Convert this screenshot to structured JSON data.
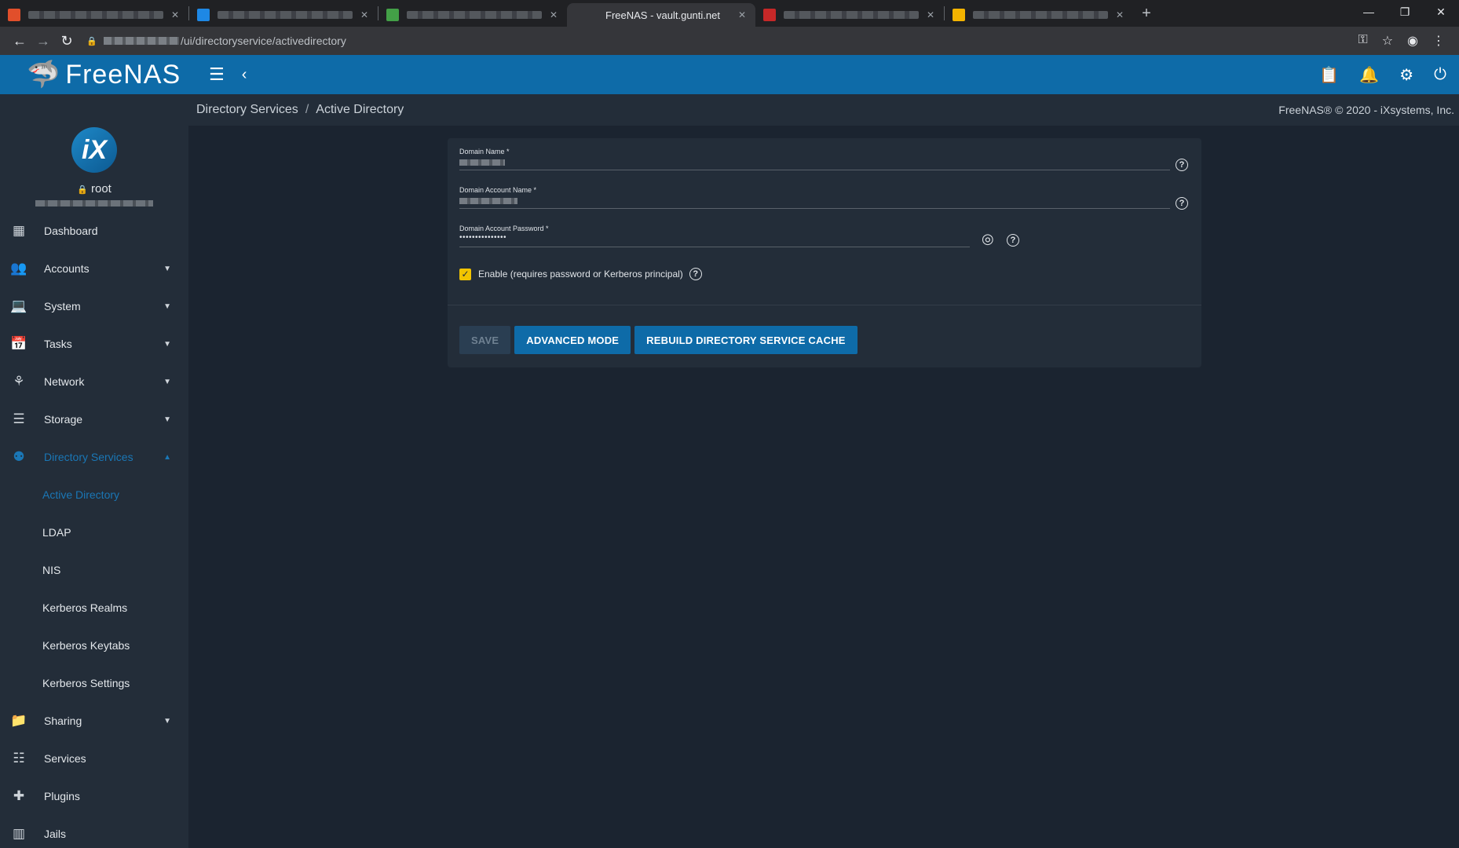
{
  "browser": {
    "tabs": [
      {
        "title": "",
        "favicon_color": "#e14f2b",
        "active": false
      },
      {
        "title": "",
        "favicon_color": "#1e88e5",
        "active": false
      },
      {
        "title": "",
        "favicon_color": "#43a047",
        "active": false
      },
      {
        "title": "FreeNAS - vault.gunti.net",
        "favicon_color": "#35363a",
        "active": true
      },
      {
        "title": "",
        "favicon_color": "#c62828",
        "active": false
      },
      {
        "title": "",
        "favicon_color": "#f4b400",
        "active": false
      }
    ],
    "url_path": "/ui/directoryservice/activedirectory"
  },
  "topbar": {
    "logo_text": "FreeNAS"
  },
  "profile": {
    "username": "root"
  },
  "sidebar": {
    "items": [
      {
        "label": "Dashboard",
        "icon": "dashboard-icon",
        "has_arrow": false
      },
      {
        "label": "Accounts",
        "icon": "accounts-icon",
        "has_arrow": true
      },
      {
        "label": "System",
        "icon": "system-icon",
        "has_arrow": true
      },
      {
        "label": "Tasks",
        "icon": "tasks-icon",
        "has_arrow": true
      },
      {
        "label": "Network",
        "icon": "network-icon",
        "has_arrow": true
      },
      {
        "label": "Storage",
        "icon": "storage-icon",
        "has_arrow": true
      },
      {
        "label": "Directory Services",
        "icon": "directory-services-icon",
        "has_arrow": true,
        "expanded": true
      }
    ],
    "subitems": [
      {
        "label": "Active Directory",
        "current": true
      },
      {
        "label": "LDAP"
      },
      {
        "label": "NIS"
      },
      {
        "label": "Kerberos Realms"
      },
      {
        "label": "Kerberos Keytabs"
      },
      {
        "label": "Kerberos Settings"
      }
    ],
    "items_after": [
      {
        "label": "Sharing",
        "icon": "sharing-icon",
        "has_arrow": true
      },
      {
        "label": "Services",
        "icon": "services-icon",
        "has_arrow": false
      },
      {
        "label": "Plugins",
        "icon": "plugins-icon",
        "has_arrow": false
      },
      {
        "label": "Jails",
        "icon": "jails-icon",
        "has_arrow": false
      }
    ]
  },
  "breadcrumb": {
    "parent": "Directory Services",
    "current": "Active Directory",
    "separator": "/"
  },
  "copyright": "FreeNAS® © 2020 - iXsystems, Inc.",
  "form": {
    "domain_name_label": "Domain Name *",
    "domain_account_name_label": "Domain Account Name *",
    "domain_account_password_label": "Domain Account Password *",
    "password_value": "•••••••••••••••",
    "enable_label": "Enable (requires password or Kerberos principal)",
    "enable_checked": true
  },
  "buttons": {
    "save": "SAVE",
    "advanced": "ADVANCED MODE",
    "rebuild": "REBUILD DIRECTORY SERVICE CACHE"
  },
  "colors": {
    "accent": "#0e6ba8",
    "sidebar_active": "#1a77b6",
    "checkbox": "#f2c400"
  }
}
